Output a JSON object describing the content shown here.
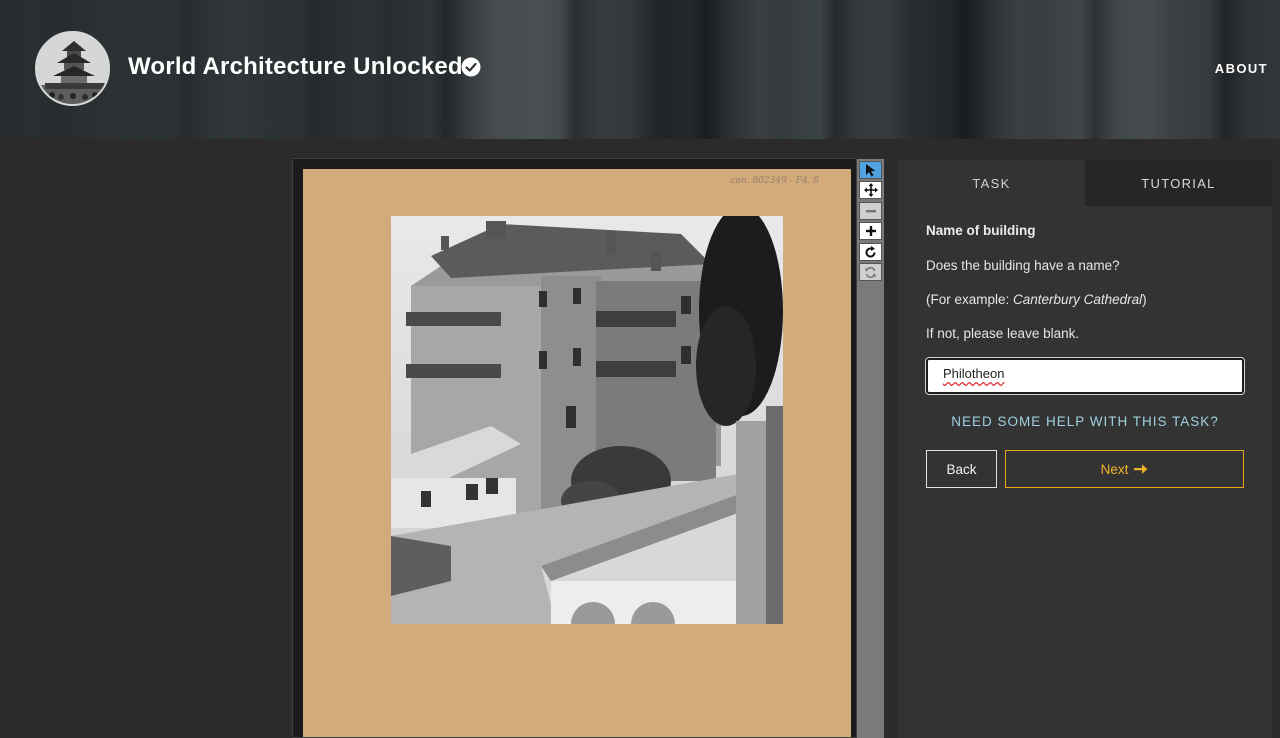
{
  "header": {
    "project_title": "World Architecture Unlocked",
    "about_label": "ABOUT",
    "avatar_icon": "pagoda-avatar",
    "verified_icon": "verified-check-icon"
  },
  "viewer": {
    "card_note": "con. 802349 - F4. 8",
    "tools": [
      {
        "name": "select-pointer-icon",
        "active": true
      },
      {
        "name": "move-pan-icon",
        "active": false
      },
      {
        "name": "zoom-out-icon",
        "active": false,
        "disabled": true
      },
      {
        "name": "zoom-in-icon",
        "active": false
      },
      {
        "name": "rotate-icon",
        "active": false
      },
      {
        "name": "reset-icon",
        "active": false,
        "disabled": true
      }
    ]
  },
  "panel": {
    "tabs": [
      {
        "label": "TASK",
        "active": true
      },
      {
        "label": "TUTORIAL",
        "active": false
      }
    ],
    "question_title": "Name of building",
    "question_text": "Does the building have a name?",
    "example_prefix": "(For example: ",
    "example_value": "Canterbury Cathedral",
    "example_suffix": ")",
    "instruction": "If not, please leave blank.",
    "answer_value": "Philotheon",
    "help_label": "NEED SOME HELP WITH THIS TASK?",
    "back_label": "Back",
    "next_label": "Next",
    "colors": {
      "next_accent": "#f0b429",
      "help_link": "#9fd0e0",
      "active_tool": "#4fa3e0"
    }
  }
}
